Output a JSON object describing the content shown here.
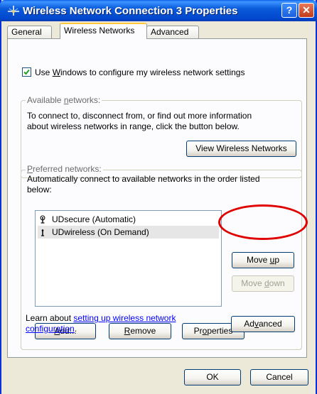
{
  "window": {
    "title": "Wireless Network Connection 3 Properties",
    "help_label": "?",
    "close_label": "✕"
  },
  "tabs": [
    {
      "label": "General",
      "active": false
    },
    {
      "label": "Wireless Networks",
      "active": true
    },
    {
      "label": "Advanced",
      "active": false
    }
  ],
  "use_windows": {
    "checked": true,
    "pre": "Use ",
    "mnemonic": "W",
    "post": "indows to configure my wireless network settings"
  },
  "available": {
    "legend_pre": "Available ",
    "legend_mnemonic": "n",
    "legend_post": "etworks:",
    "text_line1": "To connect to, disconnect from, or find out more information",
    "text_line2": "about wireless networks in range, click the button below.",
    "view_button": "View Wireless Networks"
  },
  "preferred": {
    "legend_mnemonic": "P",
    "legend_post": "referred networks:",
    "text_line1": "Automatically connect to available networks in the order listed",
    "text_line2": "below:",
    "networks": [
      {
        "name": "UDsecure (Automatic)",
        "icon": "antenna-icon",
        "selected": false
      },
      {
        "name": "UDwireless (On Demand)",
        "icon": "antenna-small-icon",
        "selected": true
      }
    ],
    "move_up_pre": "Move ",
    "move_up_mnemonic": "u",
    "move_up_post": "p",
    "move_down_pre": "Move ",
    "move_down_mnemonic": "d",
    "move_down_post": "own",
    "add_mnemonic": "A",
    "add_post": "dd...",
    "remove_mnemonic": "R",
    "remove_post": "emove",
    "properties_pre": "Pr",
    "properties_mnemonic": "o",
    "properties_post": "perties",
    "learn_pre": "Learn about ",
    "learn_link1": "setting up wireless network",
    "learn_link2": "configuration",
    "learn_end": ".",
    "advanced_pre": "Ad",
    "advanced_mnemonic": "v",
    "advanced_post": "anced"
  },
  "footer": {
    "ok": "OK",
    "cancel": "Cancel"
  },
  "colors": {
    "titlebar": "#0a5bdb",
    "annotation_circle": "#e00000"
  }
}
